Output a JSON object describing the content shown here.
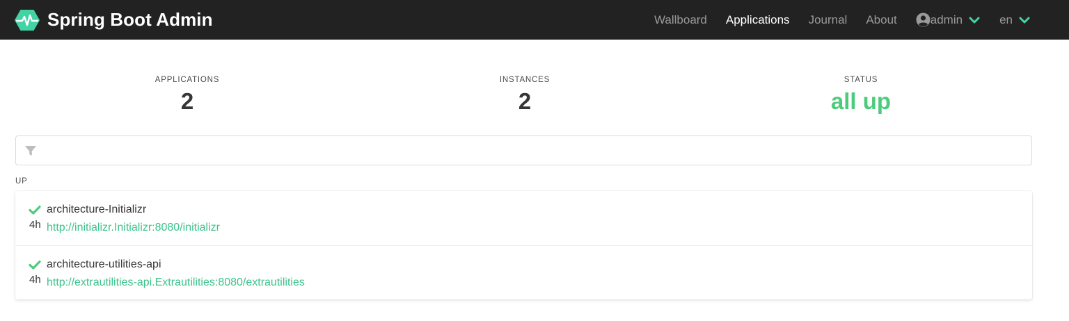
{
  "brand": {
    "name": "Spring Boot Admin"
  },
  "nav": {
    "links": [
      {
        "label": "Wallboard",
        "active": false
      },
      {
        "label": "Applications",
        "active": true
      },
      {
        "label": "Journal",
        "active": false
      },
      {
        "label": "About",
        "active": false
      }
    ],
    "user": {
      "label": "admin",
      "icon": "user-circle-icon"
    },
    "language": {
      "label": "en"
    }
  },
  "stats": {
    "applications": {
      "label": "APPLICATIONS",
      "value": "2"
    },
    "instances": {
      "label": "INSTANCES",
      "value": "2"
    },
    "status": {
      "label": "STATUS",
      "value": "all up"
    }
  },
  "filter": {
    "placeholder": "",
    "icon": "filter-icon"
  },
  "group": {
    "label": "UP",
    "applications": [
      {
        "name": "architecture-Initializr",
        "url": "http://initializr.Initializr:8080/initializr",
        "age": "4h",
        "status": "UP"
      },
      {
        "name": "architecture-utilities-api",
        "url": "http://extrautilities-api.Extrautilities:8080/extrautilities",
        "age": "4h",
        "status": "UP"
      }
    ]
  },
  "colors": {
    "navbar": "#222222",
    "accent": "#42d3a5",
    "status_up": "#4dcb7c",
    "link": "#3cc38b"
  }
}
